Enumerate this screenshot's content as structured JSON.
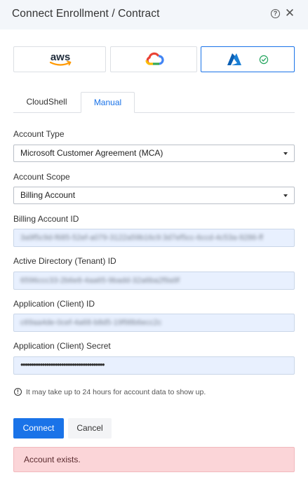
{
  "dialog": {
    "title": "Connect Enrollment / Contract"
  },
  "providers": [
    {
      "name": "aws",
      "icon": "aws-logo-icon",
      "selected": false
    },
    {
      "name": "gcp",
      "icon": "google-cloud-logo-icon",
      "selected": false
    },
    {
      "name": "azure",
      "icon": "azure-logo-icon",
      "selected": true
    }
  ],
  "tabs": [
    {
      "label": "CloudShell",
      "active": false
    },
    {
      "label": "Manual",
      "active": true
    }
  ],
  "form": {
    "account_type": {
      "label": "Account Type",
      "value": "Microsoft Customer Agreement (MCA)"
    },
    "account_scope": {
      "label": "Account Scope",
      "value": "Billing Account"
    },
    "billing_account_id": {
      "label": "Billing Account ID",
      "value": "3a9f5c9d-f685-52ef-a079-3122a59b16c9:3d7ef5cc-6ccd-4c53a-9286-ff"
    },
    "tenant_id": {
      "label": "Active Directory (Tenant) ID",
      "value": "6596ccc33-2b6e8-4aa65-9badd-32a6ba2f9a9f"
    },
    "client_id": {
      "label": "Application (Client) ID",
      "value": "c69aa4de-0cef-4a68-b8d5-19f98b6ecc2c"
    },
    "client_secret": {
      "label": "Application (Client) Secret",
      "value": "•••••••••••••••••••••••••••••••••••••••"
    }
  },
  "info": {
    "text": "It may take up to 24 hours for account data to show up."
  },
  "actions": {
    "connect_label": "Connect",
    "cancel_label": "Cancel"
  },
  "alert": {
    "text": "Account exists."
  },
  "colors": {
    "accent": "#1a73e8",
    "input_bg": "#e8f0fe",
    "alert_bg": "#fbd5d8",
    "success": "#22a45d"
  }
}
